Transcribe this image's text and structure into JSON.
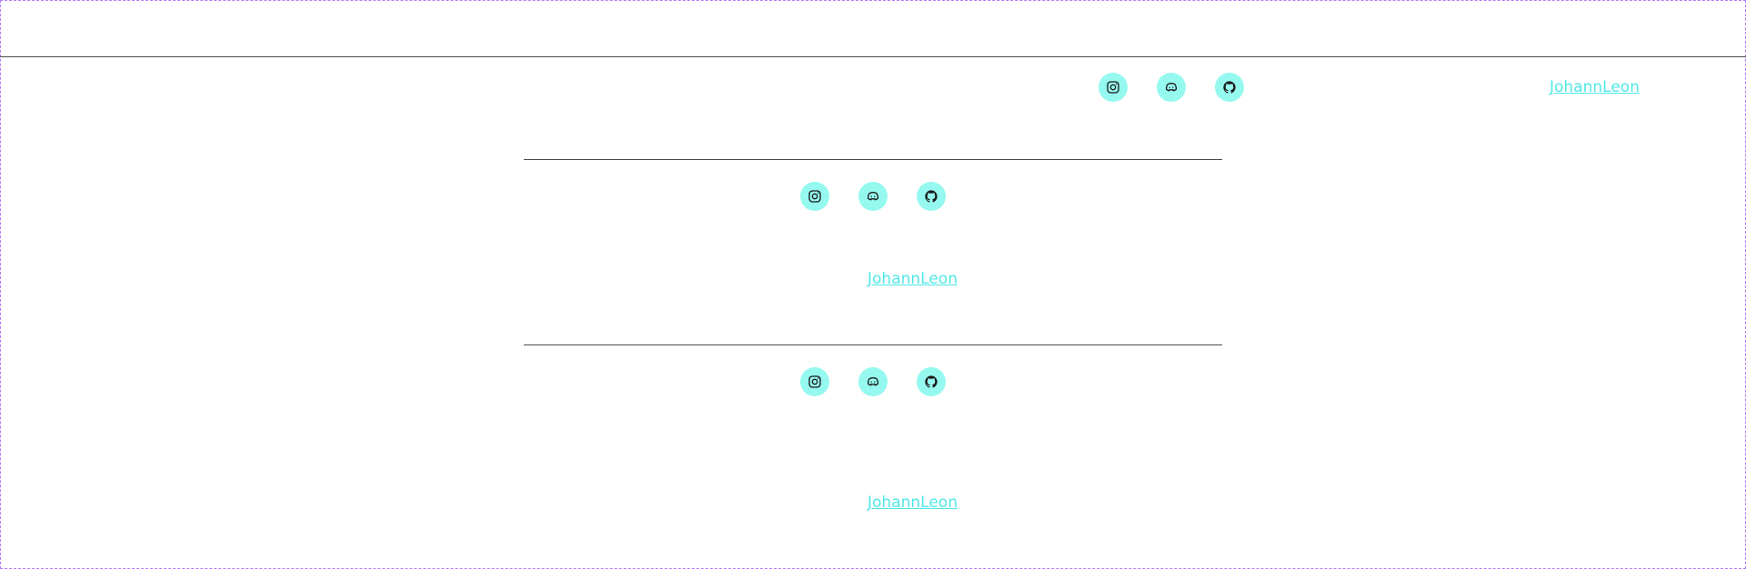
{
  "colors": {
    "frame_border": "#b27bff",
    "divider": "#4a4a4a",
    "icon_bg": "#95f9ef",
    "link": "#4ee8e6"
  },
  "sections": [
    {
      "icons": [
        "instagram-icon",
        "discord-icon",
        "github-icon"
      ],
      "link_text": "JohannLeon"
    },
    {
      "icons": [
        "instagram-icon",
        "discord-icon",
        "github-icon"
      ],
      "link_text": "JohannLeon"
    },
    {
      "icons": [
        "instagram-icon",
        "discord-icon",
        "github-icon"
      ],
      "link_text": "JohannLeon"
    }
  ]
}
